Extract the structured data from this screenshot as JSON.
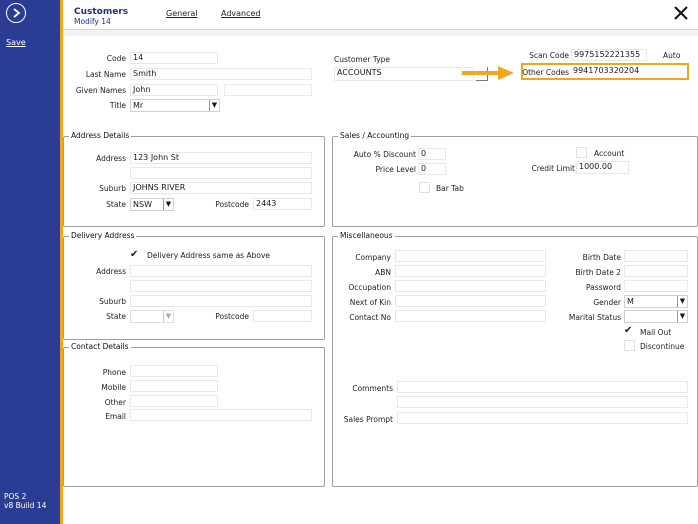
{
  "sidebar": {
    "save_label": "Save",
    "version_line1": "POS 2",
    "version_line2": "v8 Build 14"
  },
  "header": {
    "title": "Customers",
    "subtitle": "Modify 14",
    "tab_general": "General",
    "tab_advanced": "Advanced"
  },
  "customer": {
    "code_label": "Code",
    "code": "14",
    "lastname_label": "Last Name",
    "lastname": "Smith",
    "given_label": "Given Names",
    "given": "John",
    "title_label": "Title",
    "title": "Mr",
    "type_label": "Customer Type",
    "type": "ACCOUNTS",
    "scan_label": "Scan Code",
    "scan": "9975152221355",
    "auto_label": "Auto",
    "other_codes_label": "Other Codes",
    "other_codes": "9941703320204"
  },
  "address": {
    "group_title": "Address Details",
    "address_label": "Address",
    "address": "123 John St",
    "suburb_label": "Suburb",
    "suburb": "JOHNS RIVER",
    "state_label": "State",
    "state": "NSW",
    "postcode_label": "Postcode",
    "postcode": "2443"
  },
  "sales": {
    "group_title": "Sales / Accounting",
    "auto_disc_label": "Auto % Discount",
    "auto_disc": "0",
    "price_level_label": "Price Level",
    "price_level": "0",
    "account_label": "Account",
    "credit_limit_label": "Credit Limit",
    "credit_limit": "1000.00",
    "bar_tab_label": "Bar Tab"
  },
  "delivery": {
    "group_title": "Delivery Address",
    "same_label": "Delivery Address same as Above",
    "address_label": "Address",
    "suburb_label": "Suburb",
    "state_label": "State",
    "postcode_label": "Postcode"
  },
  "misc": {
    "group_title": "Miscellaneous",
    "company_label": "Company",
    "abn_label": "ABN",
    "occupation_label": "Occupation",
    "next_of_kin_label": "Next of Kin",
    "contact_no_label": "Contact No",
    "birth_date_label": "Birth Date",
    "birth_date2_label": "Birth Date 2",
    "password_label": "Password",
    "gender_label": "Gender",
    "gender": "M",
    "marital_label": "Marital Status",
    "mail_out_label": "Mail Out",
    "discontinue_label": "Discontinue",
    "comments_label": "Comments",
    "sales_prompt_label": "Sales Prompt"
  },
  "contact": {
    "group_title": "Contact Details",
    "phone_label": "Phone",
    "mobile_label": "Mobile",
    "other_label": "Other",
    "email_label": "Email"
  },
  "colors": {
    "sidebar": "#2b3c94",
    "accent": "#f3a61b"
  }
}
